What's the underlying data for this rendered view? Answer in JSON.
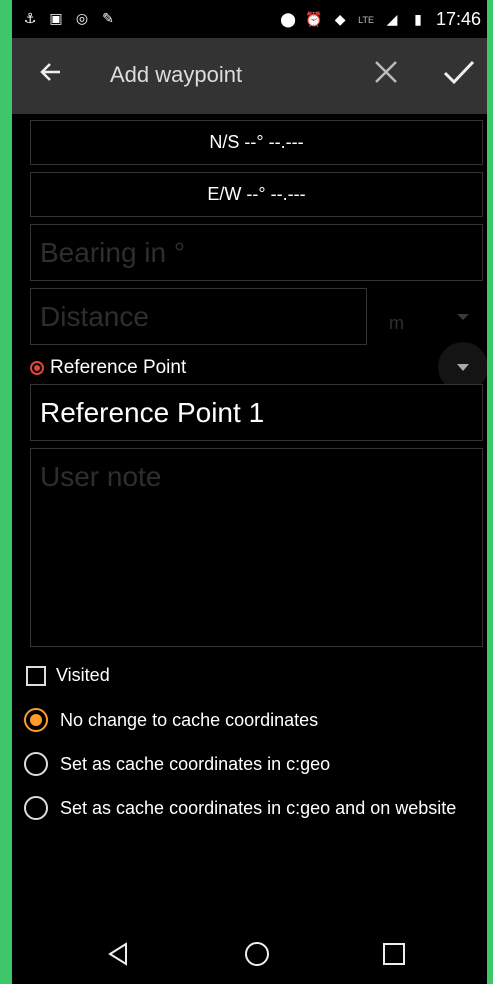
{
  "status_bar": {
    "time": "17:46",
    "network_label": "LTE"
  },
  "app_bar": {
    "title": "Add waypoint"
  },
  "coords": {
    "lat_button": "N/S --° --.---",
    "lon_button": "E/W --° --.---"
  },
  "fields": {
    "bearing_placeholder": "Bearing in °",
    "distance_placeholder": "Distance",
    "distance_unit": "m",
    "reference_label": "Reference Point",
    "reference_value": "Reference Point 1",
    "note_placeholder": "User note"
  },
  "options": {
    "visited": "Visited",
    "radio": [
      "No change to cache coordinates",
      "Set as cache coordinates in c:geo",
      "Set as cache coordinates in c:geo and on website"
    ],
    "selected_index": 0,
    "visited_checked": false
  },
  "colors": {
    "accent": "#ff9c2a",
    "reference_radio": "#e0453a",
    "side_bar": "#3ec76a"
  }
}
